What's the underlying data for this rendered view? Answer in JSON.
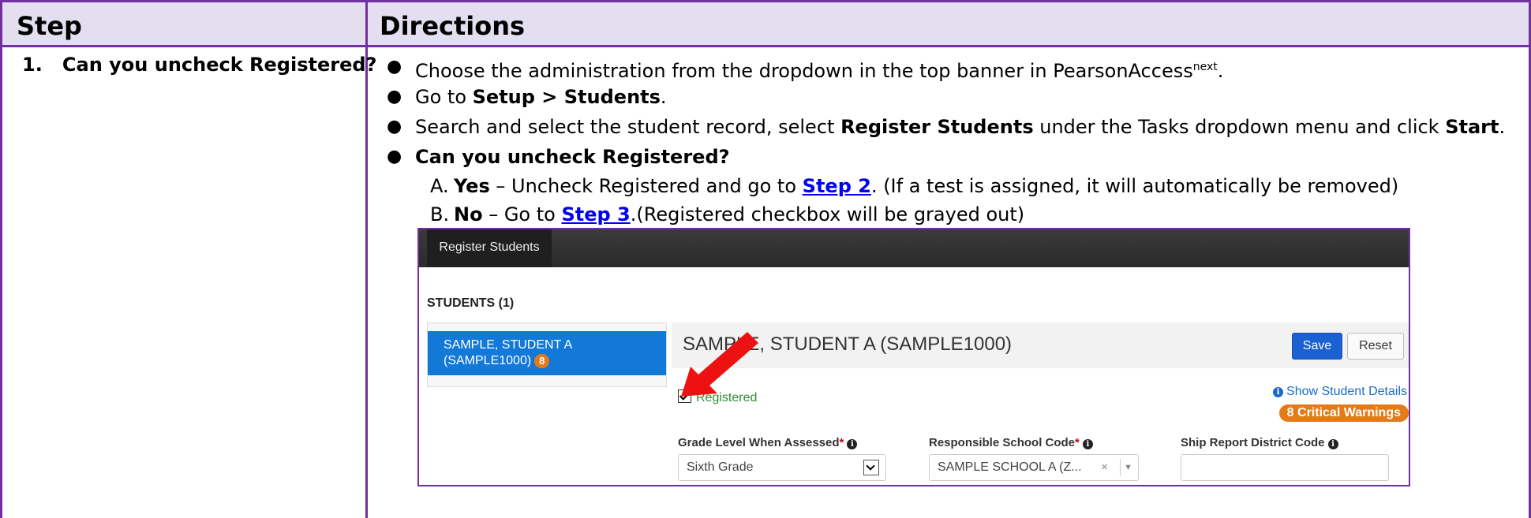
{
  "table": {
    "header_step": "Step",
    "header_directions": "Directions"
  },
  "step": {
    "number": "1.",
    "question": "Can you uncheck Registered?"
  },
  "directions": {
    "bullet1_pre": "Choose the administration from the dropdown in the top banner in PearsonAccess",
    "bullet1_sup": "next",
    "bullet1_post": ".",
    "bullet2_pre": "Go to ",
    "bullet2_bold": "Setup > Students",
    "bullet2_post": ".",
    "bullet3_pre": "Search and select the student record, select ",
    "bullet3_bold1": "Register Students",
    "bullet3_mid": " under the Tasks dropdown menu and click ",
    "bullet3_bold2": "Start",
    "bullet3_post": ".",
    "bullet4_bold": "Can you uncheck Registered?",
    "optA_label": "A.",
    "optA_bold": "Yes",
    "optA_mid": " – Uncheck Registered and go to ",
    "optA_link": "Step 2",
    "optA_post": ". (If a test is assigned, it will automatically be removed)",
    "optB_label": "B.",
    "optB_bold": "No",
    "optB_mid": " – Go to ",
    "optB_link": "Step 3",
    "optB_post": ".(Registered checkbox will be grayed out)"
  },
  "screenshot": {
    "tab_label": "Register Students",
    "students_heading": "STUDENTS (1)",
    "list_item_line1": "SAMPLE, STUDENT A",
    "list_item_line2": "(SAMPLE1000)",
    "list_item_badge": "8",
    "detail_title": "SAMPLE, STUDENT A (SAMPLE1000)",
    "save_label": "Save",
    "reset_label": "Reset",
    "registered_label": "Registered",
    "show_details": "Show Student Details",
    "critical_warnings": "8 Critical Warnings",
    "field_grade_label": "Grade Level When Assessed",
    "field_grade_value": "Sixth Grade",
    "field_school_label": "Responsible School Code",
    "field_school_value": "SAMPLE SCHOOL A (Z...",
    "field_ship_label": "Ship Report District Code",
    "field_ship_value": "",
    "required_mark": "*",
    "info_glyph": "i"
  },
  "colors": {
    "border": "#7030a0",
    "header_bg": "#e4dff0",
    "link": "#0000ee",
    "selected_item": "#1279d9",
    "save_button": "#1b61d1",
    "warning_badge": "#e57a18",
    "arrow": "#ee1111"
  }
}
